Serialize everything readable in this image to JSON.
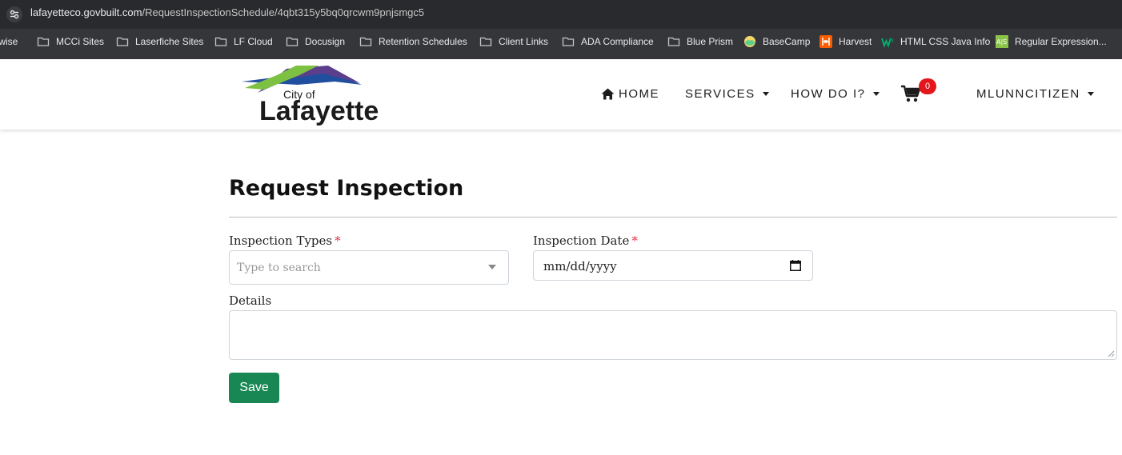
{
  "browser": {
    "url_host": "lafayetteco.govbuilt.com",
    "url_path": "/RequestInspectionSchedule/4qbt315y5bq0qrcwm9pnjsmgc5",
    "bookmarks": [
      {
        "label": "twise",
        "icon": "none"
      },
      {
        "label": "MCCi Sites",
        "icon": "folder-icon"
      },
      {
        "label": "Laserfiche Sites",
        "icon": "folder-icon"
      },
      {
        "label": "LF Cloud",
        "icon": "folder-icon"
      },
      {
        "label": "Docusign",
        "icon": "folder-icon"
      },
      {
        "label": "Retention Schedules",
        "icon": "folder-icon"
      },
      {
        "label": "Client Links",
        "icon": "folder-icon"
      },
      {
        "label": "ADA Compliance",
        "icon": "folder-icon"
      },
      {
        "label": "Blue Prism",
        "icon": "folder-icon"
      },
      {
        "label": "BaseCamp",
        "icon": "basecamp-icon"
      },
      {
        "label": "Harvest",
        "icon": "harvest-icon"
      },
      {
        "label": "HTML CSS Java Info",
        "icon": "w3-icon"
      },
      {
        "label": "Regular Expression...",
        "icon": "regex-icon"
      }
    ]
  },
  "site": {
    "logo_top": "City of",
    "logo_name": "Lafayette",
    "nav": {
      "home": "HOME",
      "services": "SERVICES",
      "how_do_i": "HOW DO I?",
      "cart_count": "0",
      "user": "MLUNNCITIZEN"
    }
  },
  "form": {
    "title": "Request Inspection",
    "inspection_types_label": "Inspection Types",
    "inspection_types_placeholder": "Type to search",
    "inspection_date_label": "Inspection Date",
    "inspection_date_value": "mm/dd/yyyy",
    "required_mark": "*",
    "details_label": "Details",
    "details_value": "",
    "save_label": "Save"
  },
  "colors": {
    "primary_button": "#198754",
    "required": "#dc3545",
    "cart_badge": "#e4161b"
  }
}
